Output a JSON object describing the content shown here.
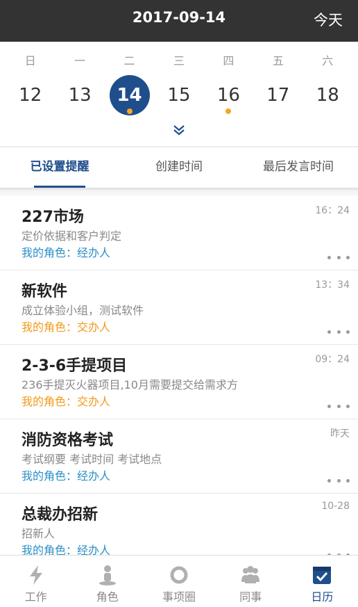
{
  "header": {
    "date": "2017-09-14",
    "today_label": "今天"
  },
  "calendar": {
    "weekdays": [
      "日",
      "一",
      "二",
      "三",
      "四",
      "五",
      "六"
    ],
    "days": [
      {
        "num": "12",
        "selected": false,
        "dot": false
      },
      {
        "num": "13",
        "selected": false,
        "dot": false
      },
      {
        "num": "14",
        "selected": true,
        "dot": true
      },
      {
        "num": "15",
        "selected": false,
        "dot": false
      },
      {
        "num": "16",
        "selected": false,
        "dot": true
      },
      {
        "num": "17",
        "selected": false,
        "dot": false
      },
      {
        "num": "18",
        "selected": false,
        "dot": false
      }
    ]
  },
  "tabs": [
    "已设置提醒",
    "创建时间",
    "最后发言时间"
  ],
  "items": [
    {
      "title": "227市场",
      "desc": "定价依据和客户判定",
      "role": "我的角色：经办人",
      "time": "16：24"
    },
    {
      "title": "新软件",
      "desc": "成立体验小组，测试软件",
      "role": "我的角色：交办人",
      "time": "13：34"
    },
    {
      "title": "2-3-6手提项目",
      "desc": "236手提灭火器项目,10月需要提交给需求方",
      "role": "我的角色：交办人",
      "time": "09：24"
    },
    {
      "title": "消防资格考试",
      "desc": "考试纲要 考试时间 考试地点",
      "role": "我的角色：经办人",
      "time": "昨天"
    },
    {
      "title": "总裁办招新",
      "desc": "招新人",
      "role": "我的角色：经办人",
      "time": "10-28"
    }
  ],
  "nav": [
    "工作",
    "角色",
    "事项圈",
    "同事",
    "日历"
  ],
  "colors": {
    "header": "#333333",
    "accent": "#1f4e8c",
    "role_handler": "#2a8fc7",
    "role_assigner": "#f29a1a",
    "dot": "#f5a623"
  },
  "icons": {
    "nav": [
      "lightning-icon",
      "person-icon",
      "circle-icon",
      "group-icon",
      "calendar-check-icon"
    ]
  }
}
